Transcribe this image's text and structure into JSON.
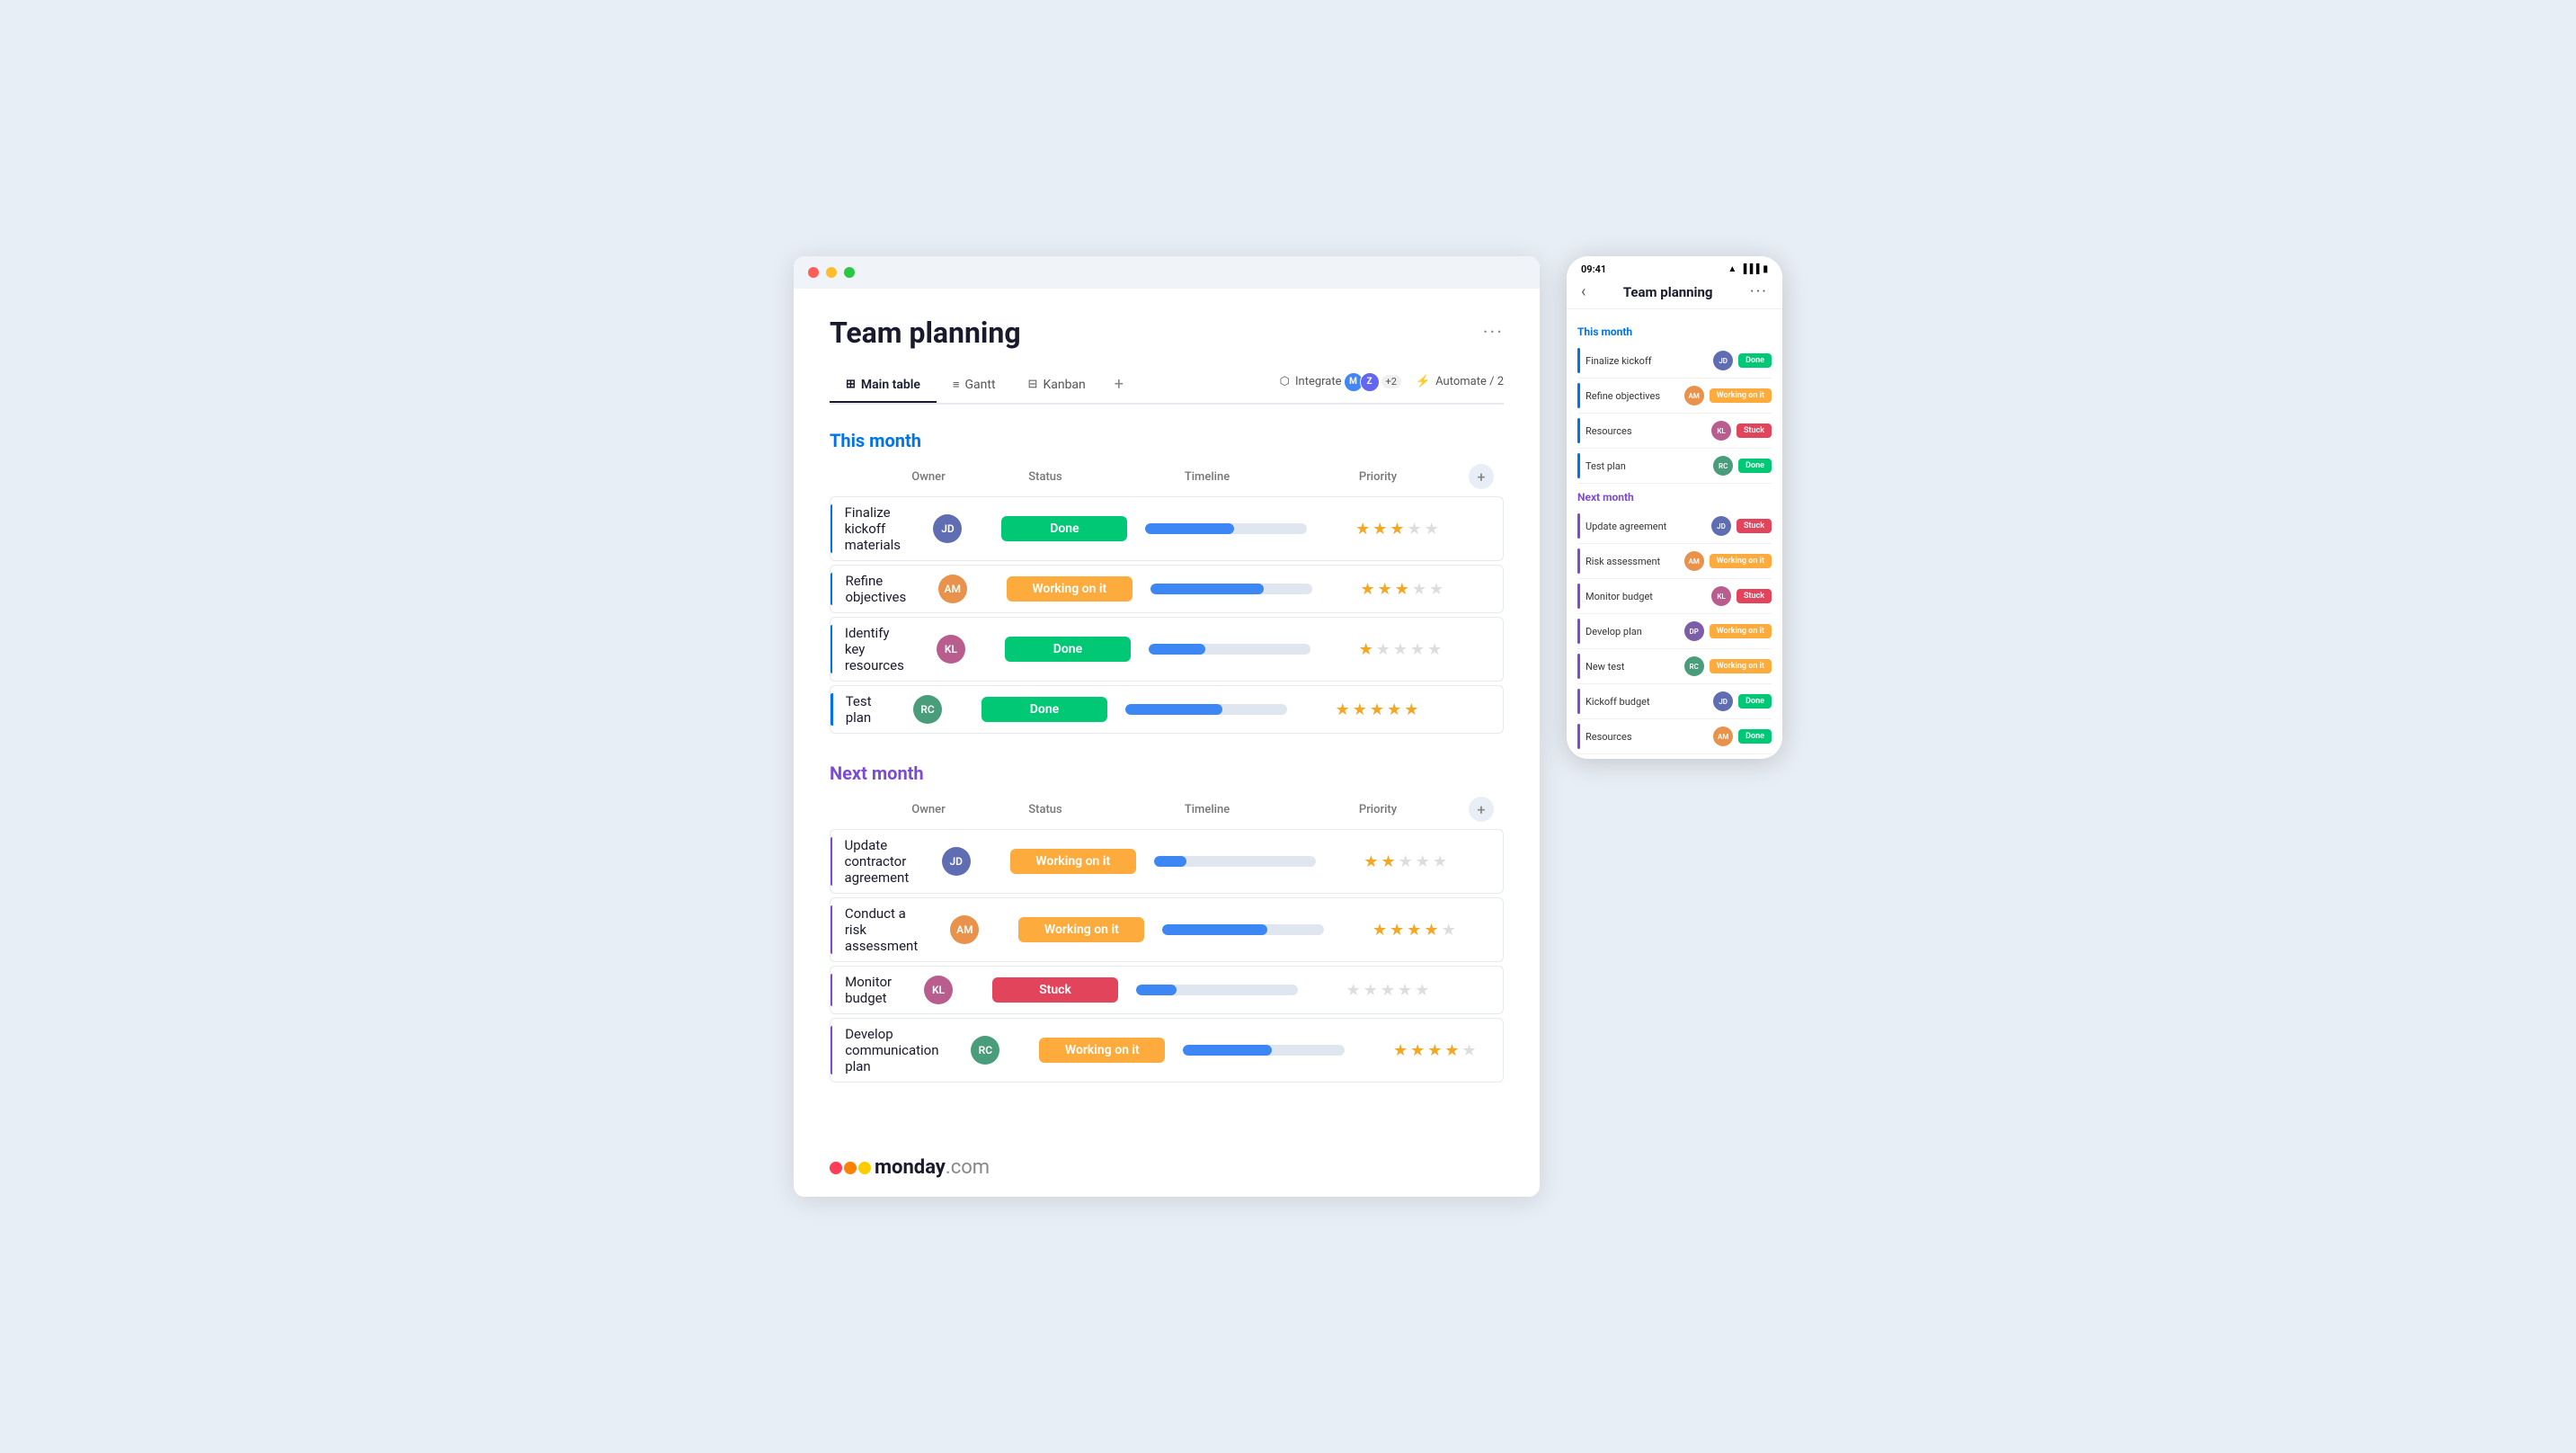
{
  "app": {
    "title": "Team planning",
    "more_options": "···"
  },
  "tabs": [
    {
      "id": "main-table",
      "label": "Main table",
      "icon": "⊞",
      "active": true
    },
    {
      "id": "gantt",
      "label": "Gantt",
      "icon": "≡"
    },
    {
      "id": "kanban",
      "label": "Kanban",
      "icon": "⊟"
    }
  ],
  "tab_add": "+",
  "toolbar": {
    "integrate_label": "Integrate",
    "integrate_icon": "⬡",
    "automate_label": "Automate / 2",
    "automate_icon": "⚡"
  },
  "groups": [
    {
      "id": "this-month",
      "title": "This month",
      "color": "blue",
      "columns": [
        "Owner",
        "Status",
        "Timeline",
        "Priority"
      ],
      "rows": [
        {
          "name": "Finalize kickoff materials",
          "owner_initials": "JD",
          "owner_color": "av1",
          "status": "Done",
          "status_class": "status-done",
          "timeline_pct": 55,
          "stars": 3,
          "total_stars": 5
        },
        {
          "name": "Refine objectives",
          "owner_initials": "AM",
          "owner_color": "av2",
          "status": "Working on it",
          "status_class": "status-working",
          "timeline_pct": 70,
          "stars": 3,
          "total_stars": 5
        },
        {
          "name": "Identify key resources",
          "owner_initials": "KL",
          "owner_color": "av3",
          "status": "Done",
          "status_class": "status-done",
          "timeline_pct": 35,
          "stars": 1,
          "total_stars": 5
        },
        {
          "name": "Test plan",
          "owner_initials": "RC",
          "owner_color": "av4",
          "status": "Done",
          "status_class": "status-done",
          "timeline_pct": 60,
          "stars": 5,
          "total_stars": 5
        }
      ]
    },
    {
      "id": "next-month",
      "title": "Next month",
      "color": "purple",
      "columns": [
        "Owner",
        "Status",
        "Timeline",
        "Priority"
      ],
      "rows": [
        {
          "name": "Update contractor agreement",
          "owner_initials": "JD",
          "owner_color": "av1",
          "status": "Working on it",
          "status_class": "status-working",
          "timeline_pct": 20,
          "stars": 2,
          "total_stars": 5
        },
        {
          "name": "Conduct a risk assessment",
          "owner_initials": "AM",
          "owner_color": "av2",
          "status": "Working on it",
          "status_class": "status-working",
          "timeline_pct": 65,
          "stars": 4,
          "total_stars": 5
        },
        {
          "name": "Monitor budget",
          "owner_initials": "KL",
          "owner_color": "av3",
          "status": "Stuck",
          "status_class": "status-stuck",
          "timeline_pct": 25,
          "stars": 0,
          "total_stars": 5
        },
        {
          "name": "Develop communication plan",
          "owner_initials": "RC",
          "owner_color": "av4",
          "status": "Working on it",
          "status_class": "status-working",
          "timeline_pct": 55,
          "stars": 4,
          "total_stars": 5
        }
      ]
    }
  ],
  "mobile": {
    "title": "Team planning",
    "time": "09:41",
    "groups": [
      {
        "title": "This month",
        "color": "m-blue",
        "bar_color": "lb-blue",
        "rows": [
          {
            "name": "Finalize kickoff",
            "av_color": "av1",
            "status": "Done",
            "status_class": "m-done"
          },
          {
            "name": "Refine objectives",
            "av_color": "av2",
            "status": "Working on it",
            "status_class": "m-working"
          },
          {
            "name": "Resources",
            "av_color": "av3",
            "status": "Stuck",
            "status_class": "m-stuck"
          },
          {
            "name": "Test plan",
            "av_color": "av4",
            "status": "Done",
            "status_class": "m-done"
          }
        ]
      },
      {
        "title": "Next month",
        "color": "m-purple",
        "bar_color": "lb-purple",
        "rows": [
          {
            "name": "Update agreement",
            "av_color": "av1",
            "status": "Stuck",
            "status_class": "m-stuck"
          },
          {
            "name": "Risk assessment",
            "av_color": "av2",
            "status": "Working on it",
            "status_class": "m-working"
          },
          {
            "name": "Monitor budget",
            "av_color": "av3",
            "status": "Stuck",
            "status_class": "m-stuck"
          },
          {
            "name": "Develop plan",
            "av_color": "av5",
            "status": "Working on it",
            "status_class": "m-working"
          },
          {
            "name": "New test",
            "av_color": "av4",
            "status": "Working on it",
            "status_class": "m-working"
          },
          {
            "name": "Kickoff budget",
            "av_color": "av1",
            "status": "Done",
            "status_class": "m-done"
          },
          {
            "name": "Resources",
            "av_color": "av2",
            "status": "Done",
            "status_class": "m-done"
          }
        ]
      }
    ]
  },
  "logo": {
    "text": "monday",
    "com": ".com"
  }
}
